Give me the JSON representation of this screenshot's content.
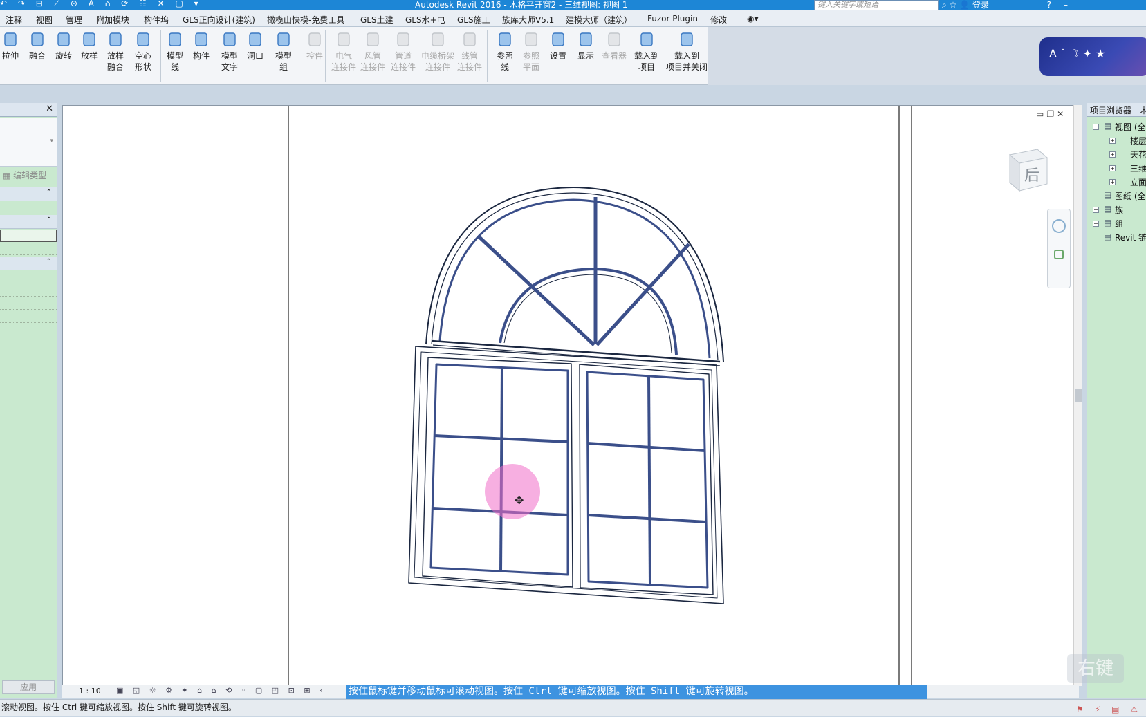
{
  "titlebar": {
    "title": "Autodesk Revit 2016 -     木格平开窗2 - 三维视图: 视图 1",
    "search_placeholder": "键入关键字或短语",
    "login": "登录",
    "qat_text": "↶ ↷ ⊟ ⟋ ⊙ A ⌂ ⟳ ☷ ✕ ▢ ▾"
  },
  "menubar": {
    "tabs": [
      "注释",
      "视图",
      "管理",
      "附加模块",
      "构件坞",
      "GLS正向设计(建筑)",
      "橄榄山快模-免费工具",
      "GLS土建",
      "GLS水+电",
      "GLS施工",
      "族库大师V5.1",
      "建模大师（建筑）",
      "Fuzor Plugin",
      "修改"
    ]
  },
  "ribbon": {
    "buttons": [
      {
        "label": "拉伸",
        "enabled": true
      },
      {
        "label": "融合",
        "enabled": true
      },
      {
        "label": "旋转",
        "enabled": true
      },
      {
        "label": "放样",
        "enabled": true
      },
      {
        "label": "放样\n融合",
        "enabled": true
      },
      {
        "label": "空心\n形状",
        "enabled": true
      },
      {
        "label": "模型\n线",
        "enabled": true
      },
      {
        "label": "构件",
        "enabled": true
      },
      {
        "label": "模型\n文字",
        "enabled": true
      },
      {
        "label": "洞口",
        "enabled": true
      },
      {
        "label": "模型\n组",
        "enabled": true
      },
      {
        "label": "控件",
        "enabled": false
      },
      {
        "label": "电气\n连接件",
        "enabled": false
      },
      {
        "label": "风管\n连接件",
        "enabled": false
      },
      {
        "label": "管道\n连接件",
        "enabled": false
      },
      {
        "label": "电缆桥架\n连接件",
        "enabled": false
      },
      {
        "label": "线管\n连接件",
        "enabled": false
      },
      {
        "label": "参照\n线",
        "enabled": true
      },
      {
        "label": "参照\n平面",
        "enabled": false
      },
      {
        "label": "设置",
        "enabled": true
      },
      {
        "label": "显示",
        "enabled": true
      },
      {
        "label": "查看器",
        "enabled": false
      },
      {
        "label": "载入到\n项目",
        "enabled": true
      },
      {
        "label": "载入到\n项目并关闭",
        "enabled": true
      }
    ]
  },
  "badge": {
    "text": "A ˙ ☽ ✦ ★"
  },
  "properties": {
    "edit_type": "编辑类型",
    "apply": "应用"
  },
  "project_browser": {
    "title": "项目浏览器 - 木",
    "nodes": [
      {
        "label": "视图 (全",
        "level": 0,
        "exp": "−"
      },
      {
        "label": "楼层平",
        "level": 1,
        "exp": "+"
      },
      {
        "label": "天花板",
        "level": 1,
        "exp": "+"
      },
      {
        "label": "三维视",
        "level": 1,
        "exp": "+"
      },
      {
        "label": "立面 (立",
        "level": 1,
        "exp": "+"
      },
      {
        "label": "图纸 (全",
        "level": 0,
        "exp": ""
      },
      {
        "label": "族",
        "level": 0,
        "exp": "+"
      },
      {
        "label": "组",
        "level": 0,
        "exp": "+"
      },
      {
        "label": "Revit 链",
        "level": 0,
        "exp": ""
      }
    ]
  },
  "viewcube": {
    "face": "后"
  },
  "viewbar": {
    "scale": "1 : 10"
  },
  "hint": "按住鼠标键并移动鼠标可滚动视图。按住 Ctrl 键可缩放视图。按住 Shift 键可旋转视图。",
  "status": "滚动视图。按住 Ctrl 键可缩放视图。按住 Shift 键可旋转视图。",
  "watermark": "右键"
}
